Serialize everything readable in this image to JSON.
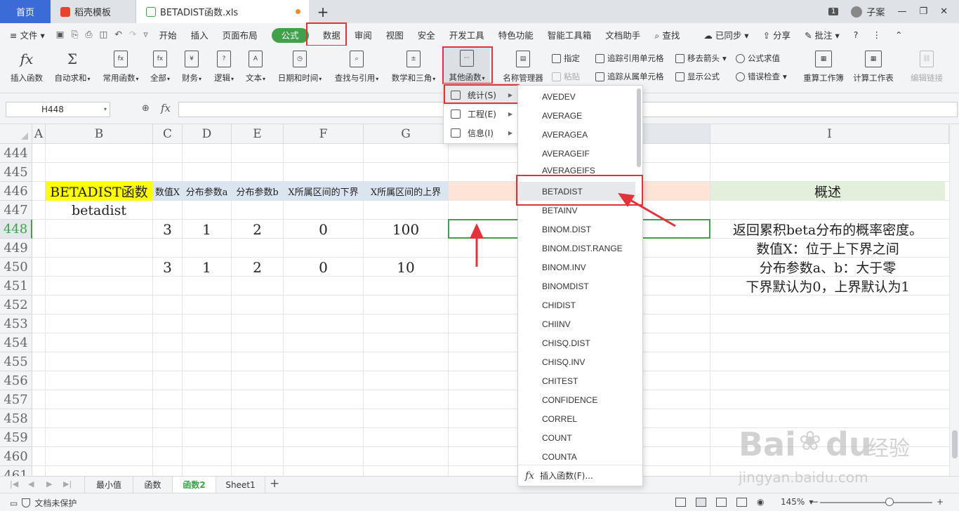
{
  "tabs": [
    {
      "label": "首页"
    },
    {
      "label": "稻壳模板"
    },
    {
      "label": "BETADIST函数.xls"
    }
  ],
  "window": {
    "badge": "1",
    "user": "子案"
  },
  "menu": {
    "file": "文件",
    "tabs": [
      "开始",
      "插入",
      "页面布局",
      "公式",
      "数据",
      "审阅",
      "视图",
      "安全",
      "开发工具",
      "特色功能",
      "智能工具箱",
      "文档助手"
    ],
    "active": "公式",
    "search": "查找",
    "synced": "已同步",
    "share": "分享",
    "annotate": "批注"
  },
  "ribbon": {
    "insert_func": "插入函数",
    "autosum": "自动求和",
    "common": "常用函数",
    "all": "全部",
    "finance": "财务",
    "logic": "逻辑",
    "text": "文本",
    "datetime": "日期和时间",
    "lookup": "查找与引用",
    "math": "数学和三角",
    "other": "其他函数",
    "name_mgr": "名称管理器",
    "define": "指定",
    "paste": "粘贴",
    "trace_prec": "追踪引用单元格",
    "trace_dep": "追踪从属单元格",
    "remove_arrows": "移去箭头",
    "show_formula": "显示公式",
    "eval_formula": "公式求值",
    "error_check": "错误检查",
    "recalc_book": "重算工作簿",
    "calc_sheet": "计算工作表",
    "edit_links": "编辑链接"
  },
  "formula_bar": {
    "name_box": "H448",
    "fx": "fx"
  },
  "columns": [
    "A",
    "B",
    "C",
    "D",
    "E",
    "F",
    "G",
    "I"
  ],
  "rows": [
    "444",
    "445",
    "446",
    "447",
    "448",
    "449",
    "450",
    "451",
    "452",
    "453",
    "454",
    "455",
    "456",
    "457",
    "458",
    "459",
    "460",
    "461"
  ],
  "sheet": {
    "title": "BETADIST函数",
    "subtitle": "betadist",
    "headers": [
      "数值X",
      "分布参数a",
      "分布参数b",
      "X所属区间的下界",
      "X所属区间的上界"
    ],
    "row448": [
      "3",
      "1",
      "2",
      "0",
      "100"
    ],
    "row450": [
      "3",
      "1",
      "2",
      "0",
      "10"
    ],
    "summary_title": "概述",
    "notes": [
      "返回累积beta分布的概率密度。",
      "数值X：位于上下界之间",
      "分布参数a、b：大于零",
      "下界默认为0，上界默认为1"
    ]
  },
  "submenu": {
    "items": [
      {
        "label": "统计(S)"
      },
      {
        "label": "工程(E)"
      },
      {
        "label": "信息(I)"
      }
    ]
  },
  "functions": [
    "AVEDEV",
    "AVERAGE",
    "AVERAGEA",
    "AVERAGEIF",
    "AVERAGEIFS",
    "BETADIST",
    "BETAINV",
    "BINOM.DIST",
    "BINOM.DIST.RANGE",
    "BINOM.INV",
    "BINOMDIST",
    "CHIDIST",
    "CHIINV",
    "CHISQ.DIST",
    "CHISQ.INV",
    "CHITEST",
    "CONFIDENCE",
    "CORREL",
    "COUNT",
    "COUNTA"
  ],
  "functions_footer": "插入函数(F)...",
  "sheet_tabs": [
    "最小值",
    "函数",
    "函数2",
    "Sheet1"
  ],
  "active_sheet": "函数2",
  "status": {
    "protect": "文档未保护",
    "zoom": "145%"
  },
  "watermark": {
    "brand": "Bai",
    "brand2": "du",
    "brand_cn": "经验",
    "url": "jingyan.baidu.com"
  },
  "colors": {
    "accent": "#3fa24a",
    "highlight": "#e3333a",
    "home_tab": "#3b6bd6",
    "yellow": "#ffff00",
    "header_blue": "#dbe5f1"
  }
}
